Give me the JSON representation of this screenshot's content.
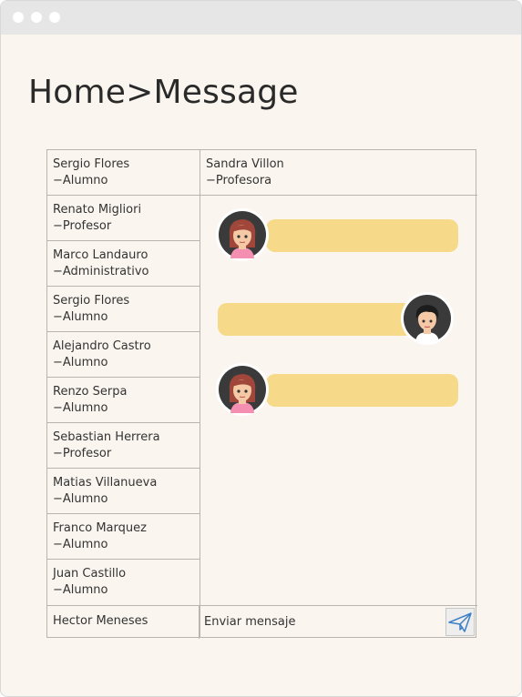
{
  "window": {
    "dots": [
      "red",
      "yellow",
      "green"
    ]
  },
  "breadcrumb": {
    "text": "Home>Message"
  },
  "conversation": {
    "name": "Sandra Villon",
    "role": "−Profesora",
    "messages": [
      {
        "from": "other",
        "text": ""
      },
      {
        "from": "me",
        "text": ""
      },
      {
        "from": "other",
        "text": ""
      }
    ]
  },
  "contacts": [
    {
      "name": "Sergio Flores",
      "role": "−Alumno"
    },
    {
      "name": "Renato Migliori",
      "role": "−Profesor"
    },
    {
      "name": "Marco Landauro",
      "role": "−Administrativo"
    },
    {
      "name": "Sergio Flores",
      "role": "−Alumno"
    },
    {
      "name": "Alejandro Castro",
      "role": "−Alumno"
    },
    {
      "name": "Renzo Serpa",
      "role": "−Alumno"
    },
    {
      "name": "Sebastian Herrera",
      "role": "−Profesor"
    },
    {
      "name": "Matias Villanueva",
      "role": "−Alumno"
    },
    {
      "name": "Franco Marquez",
      "role": "−Alumno"
    },
    {
      "name": "Juan Castillo",
      "role": "−Alumno"
    }
  ],
  "bottom_contact": {
    "name": "Hector Meneses"
  },
  "composer": {
    "placeholder": "Enviar mensaje",
    "send_icon": "paper-plane-icon"
  },
  "colors": {
    "bubble": "#f6da8a",
    "background": "#faf6ef",
    "border": "#b9b4ad",
    "send_icon": "#3d7fc4"
  }
}
